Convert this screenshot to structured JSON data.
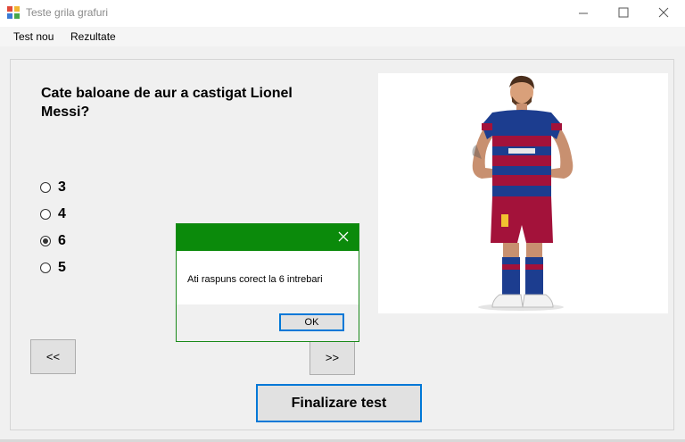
{
  "window": {
    "title": "Teste grila grafuri"
  },
  "menu": {
    "items": [
      {
        "label": "Test nou"
      },
      {
        "label": "Rezultate"
      }
    ]
  },
  "question": {
    "text": "Cate baloane de aur a castigat Lionel Messi?",
    "options": [
      {
        "label": "3",
        "selected": false
      },
      {
        "label": "4",
        "selected": false
      },
      {
        "label": "6",
        "selected": true
      },
      {
        "label": "5",
        "selected": false
      }
    ]
  },
  "buttons": {
    "prev_label": "<<",
    "next_label": ">>",
    "finish_label": "Finalizare test"
  },
  "dialog": {
    "message": "Ati raspuns corect la 6 intrebari",
    "ok_label": "OK"
  },
  "colors": {
    "dialog_title": "#0b8a0b",
    "accent": "#0078d7",
    "shirt_blue": "#1c3d8f",
    "shirt_red": "#a3123a"
  }
}
